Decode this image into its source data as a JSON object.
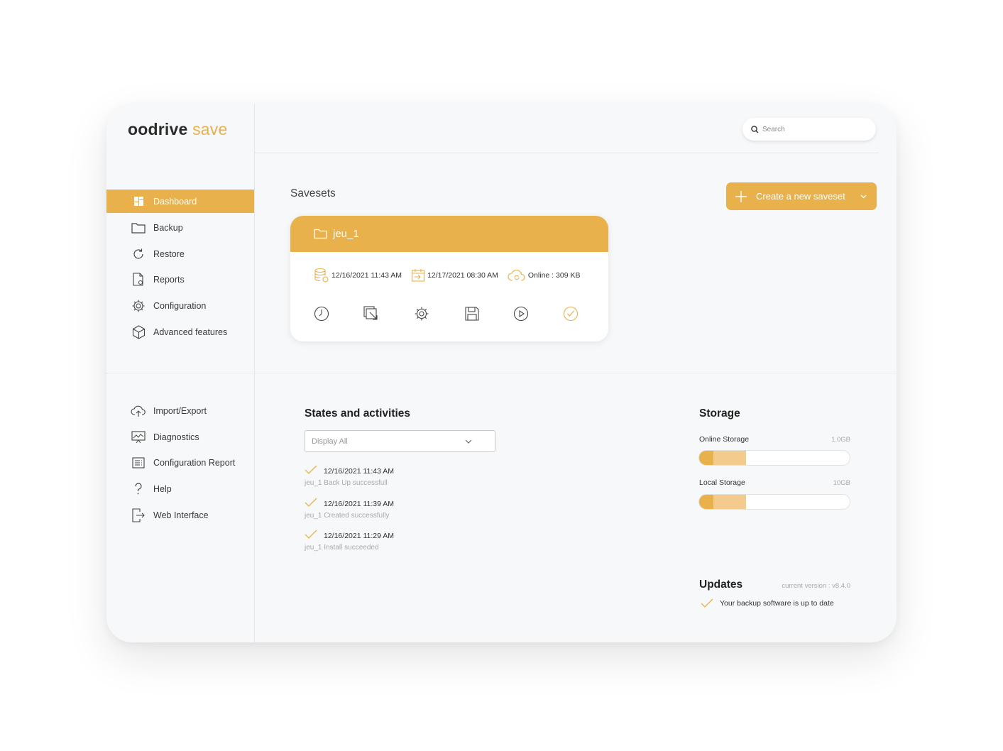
{
  "app": {
    "logo_brand": "oodrive",
    "logo_accent": "save",
    "accent_color": "#e9b14c"
  },
  "search": {
    "placeholder": "Search",
    "icon": "search-icon"
  },
  "sidebar": {
    "primary": [
      {
        "label": "Dashboard",
        "icon": "dashboard-icon",
        "active": true
      },
      {
        "label": "Backup",
        "icon": "folder-icon",
        "active": false
      },
      {
        "label": "Restore",
        "icon": "restore-icon",
        "active": false
      },
      {
        "label": "Reports",
        "icon": "report-icon",
        "active": false
      },
      {
        "label": "Configuration",
        "icon": "gear-icon",
        "active": false
      },
      {
        "label": "Advanced features",
        "icon": "cube-icon",
        "active": false
      }
    ],
    "secondary": [
      {
        "label": "Import/Export",
        "icon": "cloud-upload-icon"
      },
      {
        "label": "Diagnostics",
        "icon": "diagnostics-icon"
      },
      {
        "label": "Configuration Report",
        "icon": "list-icon"
      },
      {
        "label": "Help",
        "icon": "help-icon"
      },
      {
        "label": "Web Interface",
        "icon": "exit-icon"
      }
    ]
  },
  "savesets": {
    "title": "Savesets",
    "create_label": "Create a new saveset",
    "card": {
      "name": "jeu_1",
      "last_backup": "12/16/2021 11:43 AM",
      "next_backup": "12/17/2021 08:30 AM",
      "online": "Online : 309 KB",
      "actions": [
        "clock-icon",
        "restore-window-icon",
        "settings-icon",
        "save-icon",
        "play-icon",
        "check-circle-icon"
      ]
    }
  },
  "activities": {
    "title": "States and activities",
    "filter_value": "Display All",
    "items": [
      {
        "datetime": "12/16/2021 11:43 AM",
        "description": "jeu_1 Back Up successfull"
      },
      {
        "datetime": "12/16/2021 11:39 AM",
        "description": "jeu_1 Created successfully"
      },
      {
        "datetime": "12/16/2021 11:29 AM",
        "description": "jeu_1 Install succeeded"
      }
    ]
  },
  "storage": {
    "title": "Storage",
    "online": {
      "label": "Online Storage",
      "capacity": "1.0GB",
      "used_fraction": 0.31
    },
    "local": {
      "label": "Local Storage",
      "capacity": "10GB",
      "used_fraction": 0.31
    }
  },
  "updates": {
    "title": "Updates",
    "version": "current version : v8.4.0",
    "status": "Your backup software is up to date"
  }
}
